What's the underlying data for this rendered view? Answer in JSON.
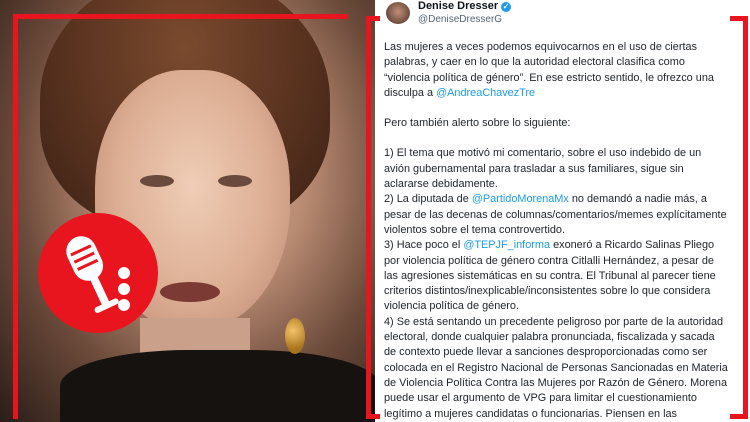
{
  "tweet": {
    "name": "Denise Dresser",
    "handle": "@DeniseDresserG",
    "p1": "Las mujeres a veces podemos equivocarnos en el uso de ciertas palabras, y caer en lo que la autoridad electoral clasifica como “violencia política de género”. En ese estricto sentido, le ofrezco una disculpa a",
    "p1_mention": "@AndreaChavezTre",
    "p2": "Pero también alerto sobre lo siguiente:",
    "item1": "1) El tema que motivó mi comentario, sobre el uso indebido de un avión gubernamental para trasladar a sus familiares, sigue sin aclararse debidamente.",
    "item2_pre": "2) La diputada de",
    "item2_mention": "@PartidoMorenaMx",
    "item2_post": "no demandó a nadie más, a pesar de las decenas de columnas/comentarios/memes explícitamente violentos sobre el tema controvertido.",
    "item3_pre": "3) Hace poco el",
    "item3_mention": "@TEPJF_informa",
    "item3_post": "exoneró a Ricardo Salinas Pliego por violencia  política de género contra Citlalli Hernández, a pesar de las agresiones sistemáticas en su contra. El Tribunal al parecer tiene criterios distintos/inexplicable/inconsistentes sobre lo que considera violencia política de género.",
    "item4": "4) Se está sentando un precedente peligroso por parte de la autoridad electoral, donde cualquier palabra pronunciada, fiscalizada y sacada de contexto puede llevar a sanciones desproporcionadas como ser colocada en el Registro Nacional de Personas Sancionadas en Materia de Violencia Política Contra las Mujeres por Razón de Género. Morena puede usar el argumento de VPG para limitar el cuestionamiento legítimo a mujeres candidatas o funcionarias. Piensen en las"
  },
  "icons": {
    "badge": "microphone-icon",
    "verified": "verified-badge-icon"
  },
  "colors": {
    "frame": "#e8141e",
    "link": "#1d9bf0",
    "text": "#1f2328"
  }
}
